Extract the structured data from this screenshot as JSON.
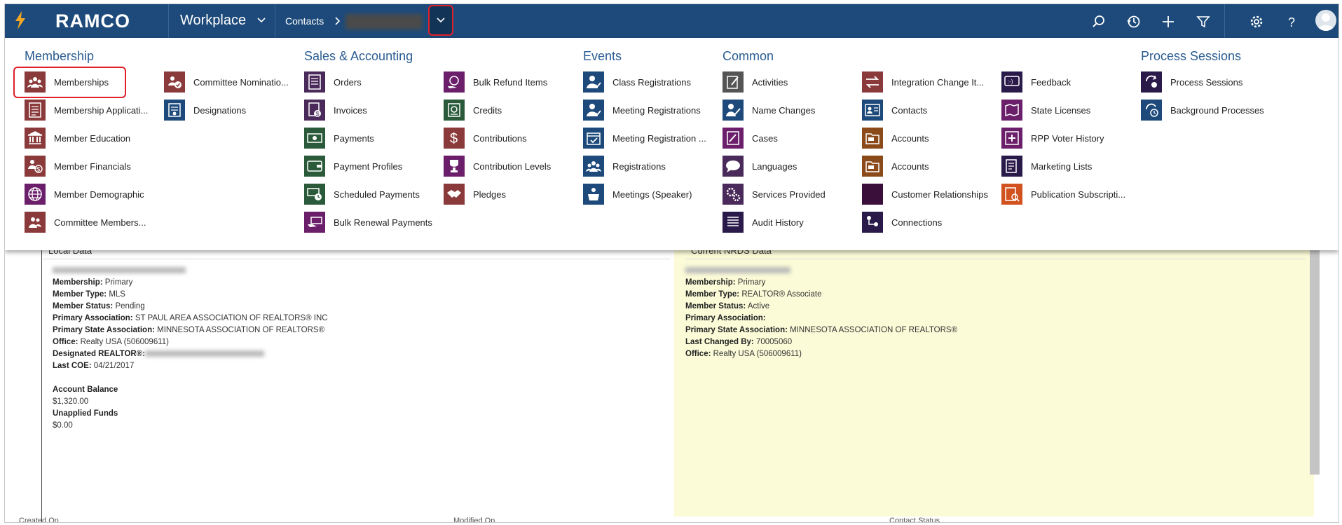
{
  "app": {
    "brand": "RAMCO",
    "workplace_label": "Workplace",
    "breadcrumb_entity": "Contacts"
  },
  "menu": {
    "sections": {
      "membership": "Membership",
      "sales": "Sales & Accounting",
      "events": "Events",
      "common": "Common",
      "process": "Process Sessions"
    },
    "items": [
      "Memberships",
      "Membership Applicati...",
      "Member Education",
      "Member Financials",
      "Member Demographic",
      "Committee Members...",
      "Committee Nominatio...",
      "Designations",
      "Orders",
      "Invoices",
      "Payments",
      "Payment Profiles",
      "Scheduled Payments",
      "Bulk Renewal Payments",
      "Bulk Refund Items",
      "Credits",
      "Contributions",
      "Contribution Levels",
      "Pledges",
      "Class Registrations",
      "Meeting Registrations",
      "Meeting Registration ...",
      "Registrations",
      "Meetings (Speaker)",
      "Activities",
      "Name Changes",
      "Cases",
      "Languages",
      "Services Provided",
      "Audit History",
      "Integration Change It...",
      "Contacts",
      "Accounts",
      "Accounts",
      "Customer Relationships",
      "Connections",
      "Feedback",
      "State Licenses",
      "RPP Voter History",
      "Marketing Lists",
      "Publication Subscripti...",
      "Process Sessions",
      "Background Processes"
    ]
  },
  "local": {
    "header": "Local Data",
    "rows": [
      {
        "label": "Membership:",
        "value": "Primary"
      },
      {
        "label": "Member Type:",
        "value": "MLS"
      },
      {
        "label": "Member Status:",
        "value": "Pending"
      },
      {
        "label": "Primary Association:",
        "value": "ST PAUL AREA ASSOCIATION OF REALTORS® INC"
      },
      {
        "label": "Primary State Association:",
        "value": "MINNESOTA ASSOCIATION OF REALTORS®"
      },
      {
        "label": "Office:",
        "value": "Realty USA (506009611)"
      },
      {
        "label": "Designated REALTOR®:",
        "value": ""
      },
      {
        "label": "Last COE:",
        "value": "04/21/2017"
      }
    ],
    "account_balance_label": "Account Balance",
    "account_balance": "$1,320.00",
    "unapplied_label": "Unapplied Funds",
    "unapplied": "$0.00"
  },
  "nrds": {
    "header": "Current NRDS Data",
    "rows": [
      {
        "label": "Membership:",
        "value": "Primary"
      },
      {
        "label": "Member Type:",
        "value": "REALTOR® Associate"
      },
      {
        "label": "Member Status:",
        "value": "Active"
      },
      {
        "label": "Primary Association:",
        "value": ""
      },
      {
        "label": "Primary State Association:",
        "value": "MINNESOTA ASSOCIATION OF REALTORS®"
      },
      {
        "label": "Last Changed By:",
        "value": "70005060"
      },
      {
        "label": "Office:",
        "value": "Realty USA (506009611)"
      }
    ]
  },
  "footer": {
    "created_label": "Created On",
    "modified_label": "Modified On",
    "status_label": "Contact Status"
  },
  "colors": {
    "topbar": "#1d4a7a",
    "section_title": "#2a5c92",
    "highlight": "#e0202a",
    "nrds_bg": "#fbfbd8"
  }
}
